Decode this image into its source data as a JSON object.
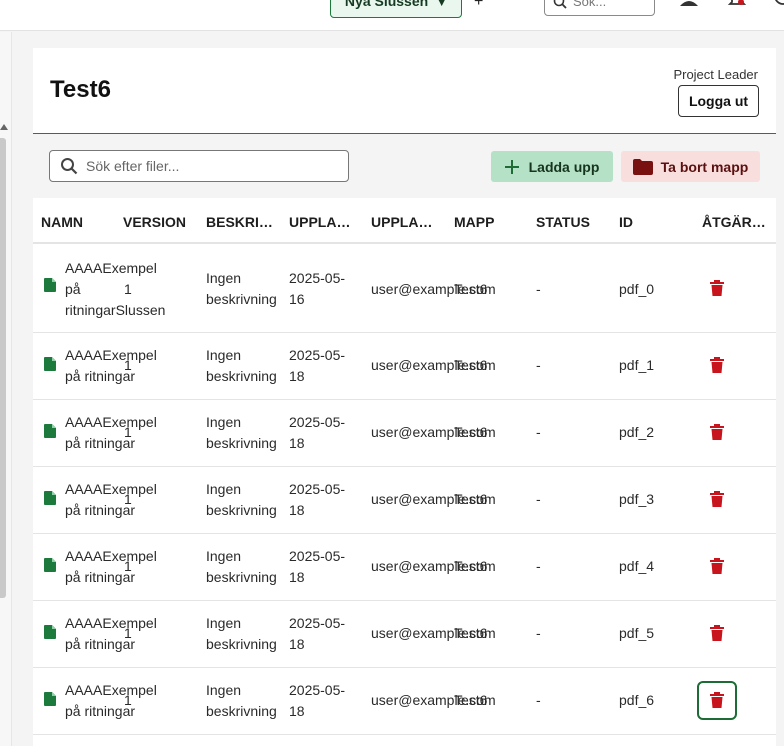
{
  "topbar": {
    "project_selector": "Nya Slussen",
    "project_caret": "▼",
    "add_label": "+",
    "search_placeholder": "Sök..."
  },
  "header": {
    "folder_title": "Test6",
    "role": "Project Leader",
    "logout_label": "Logga ut"
  },
  "toolbar": {
    "search_placeholder": "Sök efter filer...",
    "upload_label": "Ladda upp",
    "delete_folder_label": "Ta bort mapp"
  },
  "table": {
    "columns": [
      "NAMN",
      "VERSION",
      "BESKRI…",
      "UPPLA…",
      "UPPLA…",
      "MAPP",
      "STATUS",
      "ID",
      "ÅTGÄR…"
    ],
    "rows": [
      {
        "name_line1": "AAAAExempel",
        "name_line2": "på",
        "name_line3": "ritningarSlussen",
        "version": "1",
        "desc_line1": "Ingen",
        "desc_line2": "beskrivning",
        "date_line1": "2025-05-",
        "date_line2": "16",
        "uploader": "user@example.com",
        "folder": "Test6",
        "status": "-",
        "id": "pdf_0"
      },
      {
        "name_line1": "AAAAExempel",
        "name_line2": "på ritningar",
        "name_line3": "",
        "version": "1",
        "desc_line1": "Ingen",
        "desc_line2": "beskrivning",
        "date_line1": "2025-05-",
        "date_line2": "18",
        "uploader": "user@example.com",
        "folder": "Test6",
        "status": "-",
        "id": "pdf_1"
      },
      {
        "name_line1": "AAAAExempel",
        "name_line2": "på ritningar",
        "name_line3": "",
        "version": "1",
        "desc_line1": "Ingen",
        "desc_line2": "beskrivning",
        "date_line1": "2025-05-",
        "date_line2": "18",
        "uploader": "user@example.com",
        "folder": "Test6",
        "status": "-",
        "id": "pdf_2"
      },
      {
        "name_line1": "AAAAExempel",
        "name_line2": "på ritningar",
        "name_line3": "",
        "version": "1",
        "desc_line1": "Ingen",
        "desc_line2": "beskrivning",
        "date_line1": "2025-05-",
        "date_line2": "18",
        "uploader": "user@example.com",
        "folder": "Test6",
        "status": "-",
        "id": "pdf_3"
      },
      {
        "name_line1": "AAAAExempel",
        "name_line2": "på ritningar",
        "name_line3": "",
        "version": "1",
        "desc_line1": "Ingen",
        "desc_line2": "beskrivning",
        "date_line1": "2025-05-",
        "date_line2": "18",
        "uploader": "user@example.com",
        "folder": "Test6",
        "status": "-",
        "id": "pdf_4"
      },
      {
        "name_line1": "AAAAExempel",
        "name_line2": "på ritningar",
        "name_line3": "",
        "version": "1",
        "desc_line1": "Ingen",
        "desc_line2": "beskrivning",
        "date_line1": "2025-05-",
        "date_line2": "18",
        "uploader": "user@example.com",
        "folder": "Test6",
        "status": "-",
        "id": "pdf_5"
      },
      {
        "name_line1": "AAAAExempel",
        "name_line2": "på ritningar",
        "name_line3": "",
        "version": "1",
        "desc_line1": "Ingen",
        "desc_line2": "beskrivning",
        "date_line1": "2025-05-",
        "date_line2": "18",
        "uploader": "user@example.com",
        "folder": "Test6",
        "status": "-",
        "id": "pdf_6"
      }
    ]
  },
  "icons": {
    "file": "file-icon",
    "trash": "trash-icon",
    "search": "search-icon",
    "plus": "plus-icon",
    "folder": "folder-icon",
    "user": "user-icon",
    "bell": "bell-icon",
    "help": "help-icon"
  },
  "colors": {
    "file_icon": "#1b7a3c",
    "trash_icon": "#c8141c",
    "upload_bg": "#b5e1c6",
    "delete_bg": "#f9dede",
    "folder_icon": "#7a1111",
    "focus_ring": "#1d6b35"
  }
}
